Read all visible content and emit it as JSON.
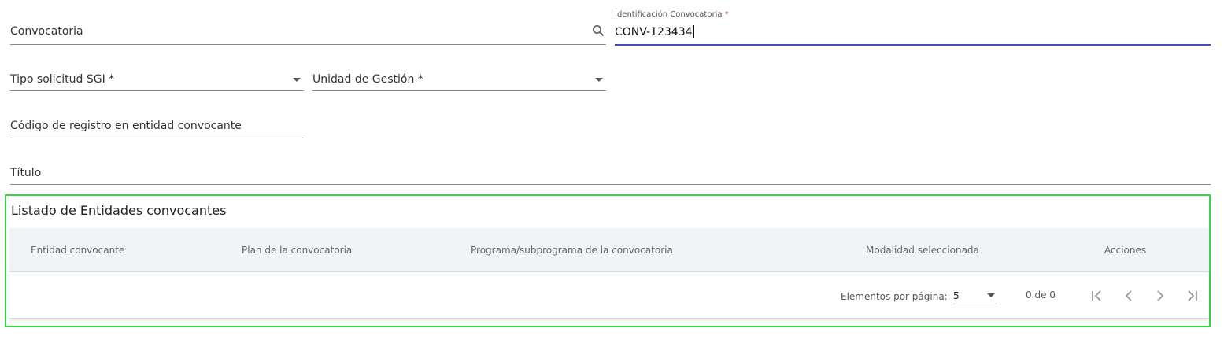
{
  "form": {
    "convocatoria_label": "Convocatoria",
    "identificacion_label": "Identificación Convocatoria",
    "identificacion_required": "*",
    "identificacion_value": "CONV-123434",
    "tipo_solicitud_label": "Tipo solicitud SGI *",
    "unidad_gestion_label": "Unidad de Gestión *",
    "codigo_registro_label": "Código de registro en entidad convocante",
    "titulo_label": "Título"
  },
  "entidades": {
    "title": "Listado de Entidades convocantes",
    "columns": [
      "Entidad convocante",
      "Plan de la convocatoria",
      "Programa/subprograma de la convocatoria",
      "Modalidad seleccionada",
      "Acciones"
    ],
    "rows": [],
    "paginator": {
      "items_per_page_label": "Elementos por página:",
      "items_per_page_value": "5",
      "range_label": "0 de 0"
    }
  },
  "icons": {
    "search": "search-icon",
    "dropdown": "chevron-down-icon",
    "first": "first-page-icon",
    "prev": "previous-page-icon",
    "next": "next-page-icon",
    "last": "last-page-icon"
  },
  "colors": {
    "focus_underline": "#3f51b5",
    "required_asterisk": "#c04a4a",
    "highlight_border": "#31d83f",
    "table_header_bg": "#f1f4f7"
  }
}
